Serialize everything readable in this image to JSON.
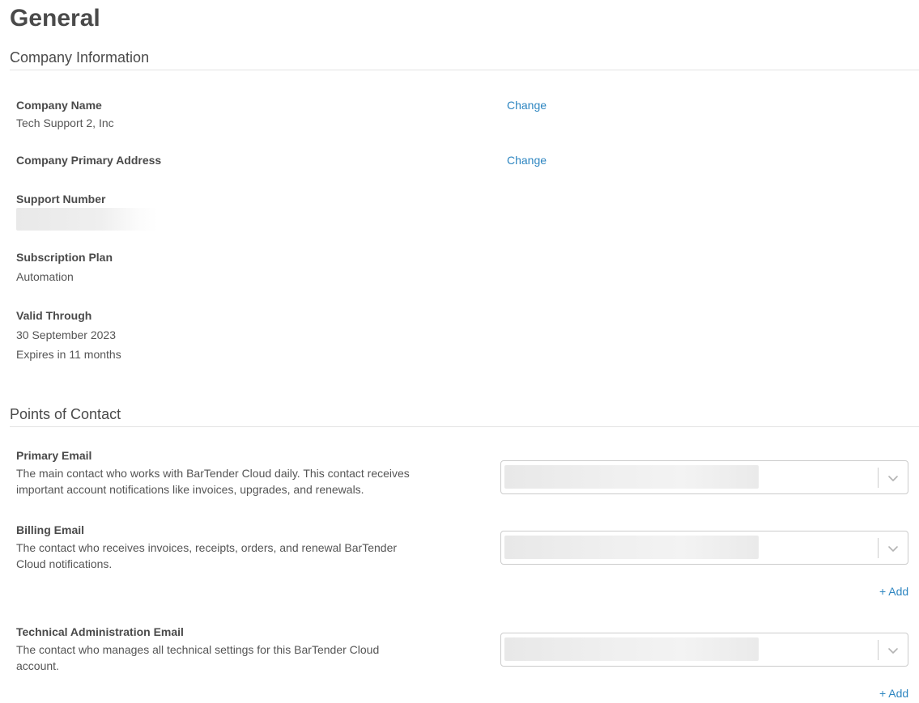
{
  "page": {
    "title": "General"
  },
  "company_information": {
    "heading": "Company Information",
    "company_name": {
      "label": "Company Name",
      "value": "Tech Support 2, Inc",
      "action": "Change"
    },
    "primary_address": {
      "label": "Company Primary Address",
      "action": "Change"
    },
    "support_number": {
      "label": "Support Number"
    },
    "subscription_plan": {
      "label": "Subscription Plan",
      "value": "Automation"
    },
    "valid_through": {
      "label": "Valid Through",
      "date": "30 September 2023",
      "expires": "Expires in 11 months"
    }
  },
  "points_of_contact": {
    "heading": "Points of Contact",
    "primary_email": {
      "label": "Primary Email",
      "description": "The main contact who works with BarTender Cloud daily. This contact receives important account notifications like invoices, upgrades, and renewals."
    },
    "billing_email": {
      "label": "Billing Email",
      "description": "The contact who receives invoices, receipts, orders, and renewal BarTender Cloud notifications.",
      "add_label": "+ Add"
    },
    "technical_email": {
      "label": "Technical Administration Email",
      "description": "The contact who manages all technical settings for this BarTender Cloud account.",
      "add_label": "+ Add"
    }
  },
  "colors": {
    "link": "#2e86c1",
    "text": "#4a4a4a",
    "border": "#cccccc"
  }
}
